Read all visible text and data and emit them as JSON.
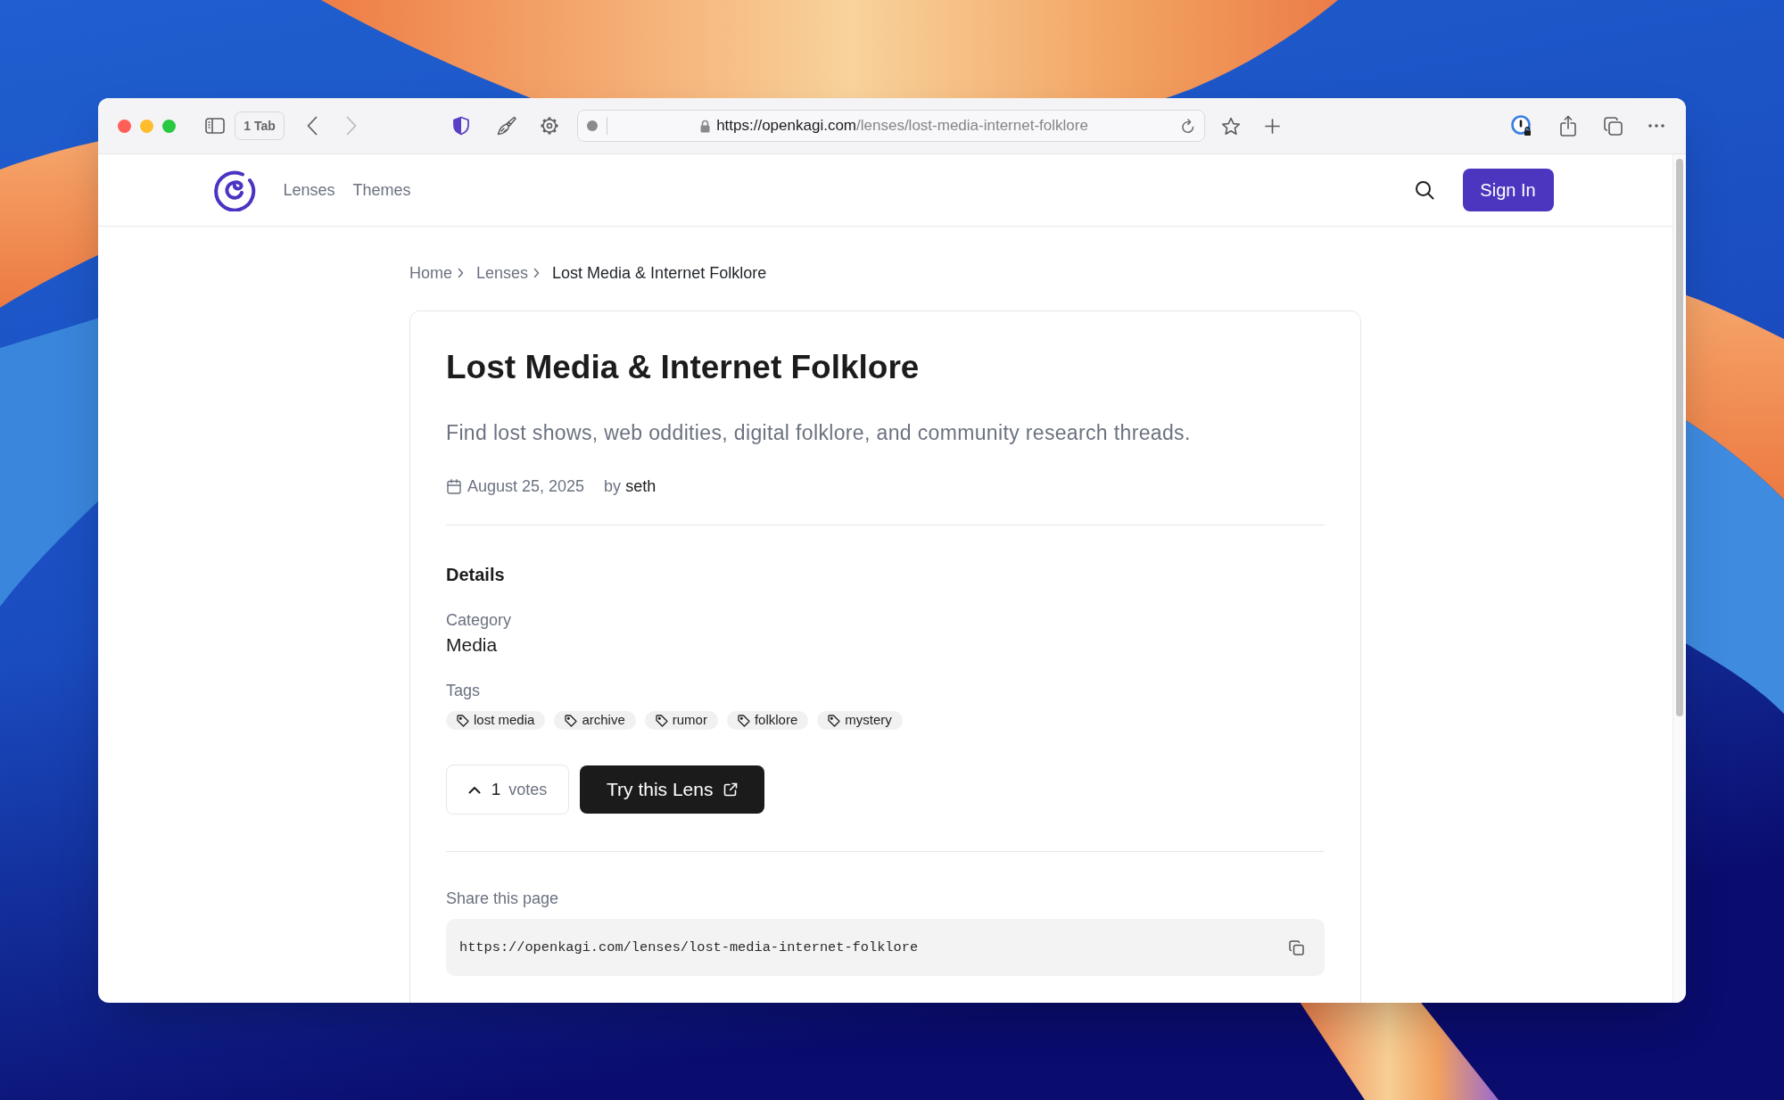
{
  "browser": {
    "tab_button": "1 Tab",
    "back": {
      "disabled": false
    },
    "forward": {
      "disabled": true
    },
    "address": {
      "domain": "https://openkagi.com",
      "path": "/lenses/lost-media-internet-folklore"
    }
  },
  "site_header": {
    "nav_links": [
      "Lenses",
      "Themes"
    ],
    "sign_in": "Sign In"
  },
  "breadcrumb": [
    {
      "label": "Home",
      "current": false
    },
    {
      "label": "Lenses",
      "current": false
    },
    {
      "label": "Lost Media & Internet Folklore",
      "current": true
    }
  ],
  "lens": {
    "title": "Lost Media & Internet Folklore",
    "description": "Find lost shows, web oddities, digital folklore, and community research threads.",
    "date": "August 25, 2025",
    "by_label": "by",
    "author": "seth",
    "details_heading": "Details",
    "category_label": "Category",
    "category": "Media",
    "tags_label": "Tags",
    "tags": [
      "lost media",
      "archive",
      "rumor",
      "folklore",
      "mystery"
    ],
    "votes": {
      "count": "1",
      "label": "votes"
    },
    "try_button": "Try this Lens"
  },
  "share": {
    "label": "Share this page",
    "url": "https://openkagi.com/lenses/lost-media-internet-folklore"
  }
}
